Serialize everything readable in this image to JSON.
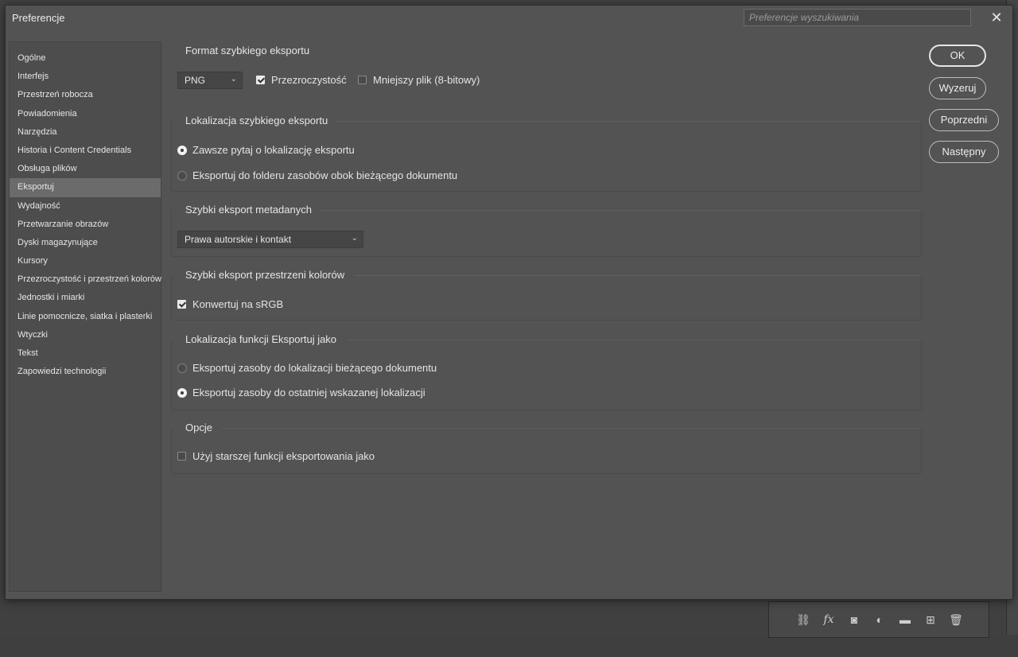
{
  "dialog": {
    "title": "Preferencje",
    "search_placeholder": "Preferencje wyszukiwania",
    "close_symbol": "✕"
  },
  "sidebar": {
    "items": [
      {
        "label": "Ogólne"
      },
      {
        "label": "Interfejs"
      },
      {
        "label": "Przestrzeń robocza"
      },
      {
        "label": "Powiadomienia"
      },
      {
        "label": "Narzędzia"
      },
      {
        "label": "Historia i Content Credentials"
      },
      {
        "label": "Obsługa plików"
      },
      {
        "label": "Eksportuj",
        "active": true
      },
      {
        "label": "Wydajność"
      },
      {
        "label": "Przetwarzanie obrazów"
      },
      {
        "label": "Dyski magazynujące"
      },
      {
        "label": "Kursory"
      },
      {
        "label": "Przezroczystość i przestrzeń kolorów"
      },
      {
        "label": "Jednostki i miarki"
      },
      {
        "label": "Linie pomocnicze, siatka i plasterki"
      },
      {
        "label": "Wtyczki"
      },
      {
        "label": "Tekst"
      },
      {
        "label": "Zapowiedzi technologii"
      }
    ]
  },
  "quick_export_format": {
    "heading": "Format szybkiego eksportu",
    "format_value": "PNG",
    "transparency_label": "Przezroczystość",
    "transparency_checked": true,
    "smaller_file_label": "Mniejszy plik (8-bitowy)",
    "smaller_file_checked": false
  },
  "quick_export_location": {
    "heading": "Lokalizacja szybkiego eksportu",
    "option_ask": "Zawsze pytaj o lokalizację eksportu",
    "option_folder": "Eksportuj do folderu zasobów obok bieżącego dokumentu",
    "selected": "ask"
  },
  "quick_export_metadata": {
    "heading": "Szybki eksport metadanych",
    "value": "Prawa autorskie i kontakt"
  },
  "quick_export_colorspace": {
    "heading": "Szybki eksport przestrzeni kolorów",
    "convert_label": "Konwertuj na sRGB",
    "convert_checked": true
  },
  "export_as_location": {
    "heading": "Lokalizacja funkcji Eksportuj jako",
    "option_current": "Eksportuj zasoby do lokalizacji bieżącego dokumentu",
    "option_last": "Eksportuj zasoby do ostatniej wskazanej lokalizacji",
    "selected": "last"
  },
  "options": {
    "heading": "Opcje",
    "legacy_label": "Użyj starszej funkcji eksportowania jako",
    "legacy_checked": false
  },
  "buttons": {
    "ok": "OK",
    "reset": "Wyzeruj",
    "prev": "Poprzedni",
    "next": "Następny"
  },
  "background_panel": {
    "icons": [
      "link-icon",
      "fx-icon",
      "mask-icon",
      "adjustment-icon",
      "folder-icon",
      "new-layer-icon",
      "trash-icon"
    ]
  }
}
